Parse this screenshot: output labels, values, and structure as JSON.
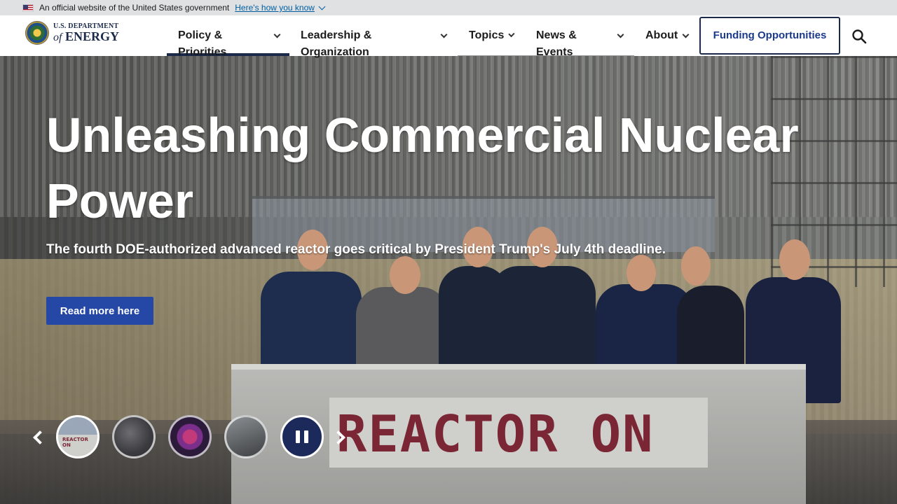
{
  "gov_banner": {
    "text": "An official website of the United States government",
    "link": "Here's how you know"
  },
  "logo": {
    "top": "U.S. DEPARTMENT",
    "of": "of",
    "bottom": "ENERGY"
  },
  "nav": {
    "items": [
      {
        "label": "Policy & Priorities"
      },
      {
        "label": "Leadership & Organization"
      },
      {
        "label": "Topics"
      },
      {
        "label": "News & Events"
      },
      {
        "label": "About"
      }
    ],
    "funding_label": "Funding Opportunities"
  },
  "hero": {
    "title": "Unleashing Commercial Nuclear Power",
    "subtitle": "The fourth DOE-authorized advanced reactor goes critical by President Trump's July 4th deadline.",
    "button_label": "Read more here",
    "table_sign": "REACTOR ON"
  },
  "carousel": {
    "thumb1_text": "REACTOR ON"
  },
  "colors": {
    "nav_active": "#1b2a4a",
    "button_blue": "#2547a5",
    "pause_bg": "#1b2a5a",
    "gov_banner_bg": "#dfe1e2"
  },
  "icons": [
    "us-flag-icon",
    "chevron-down-icon",
    "search-icon",
    "chevron-left-icon",
    "chevron-right-icon",
    "pause-icon",
    "doe-seal-icon"
  ]
}
